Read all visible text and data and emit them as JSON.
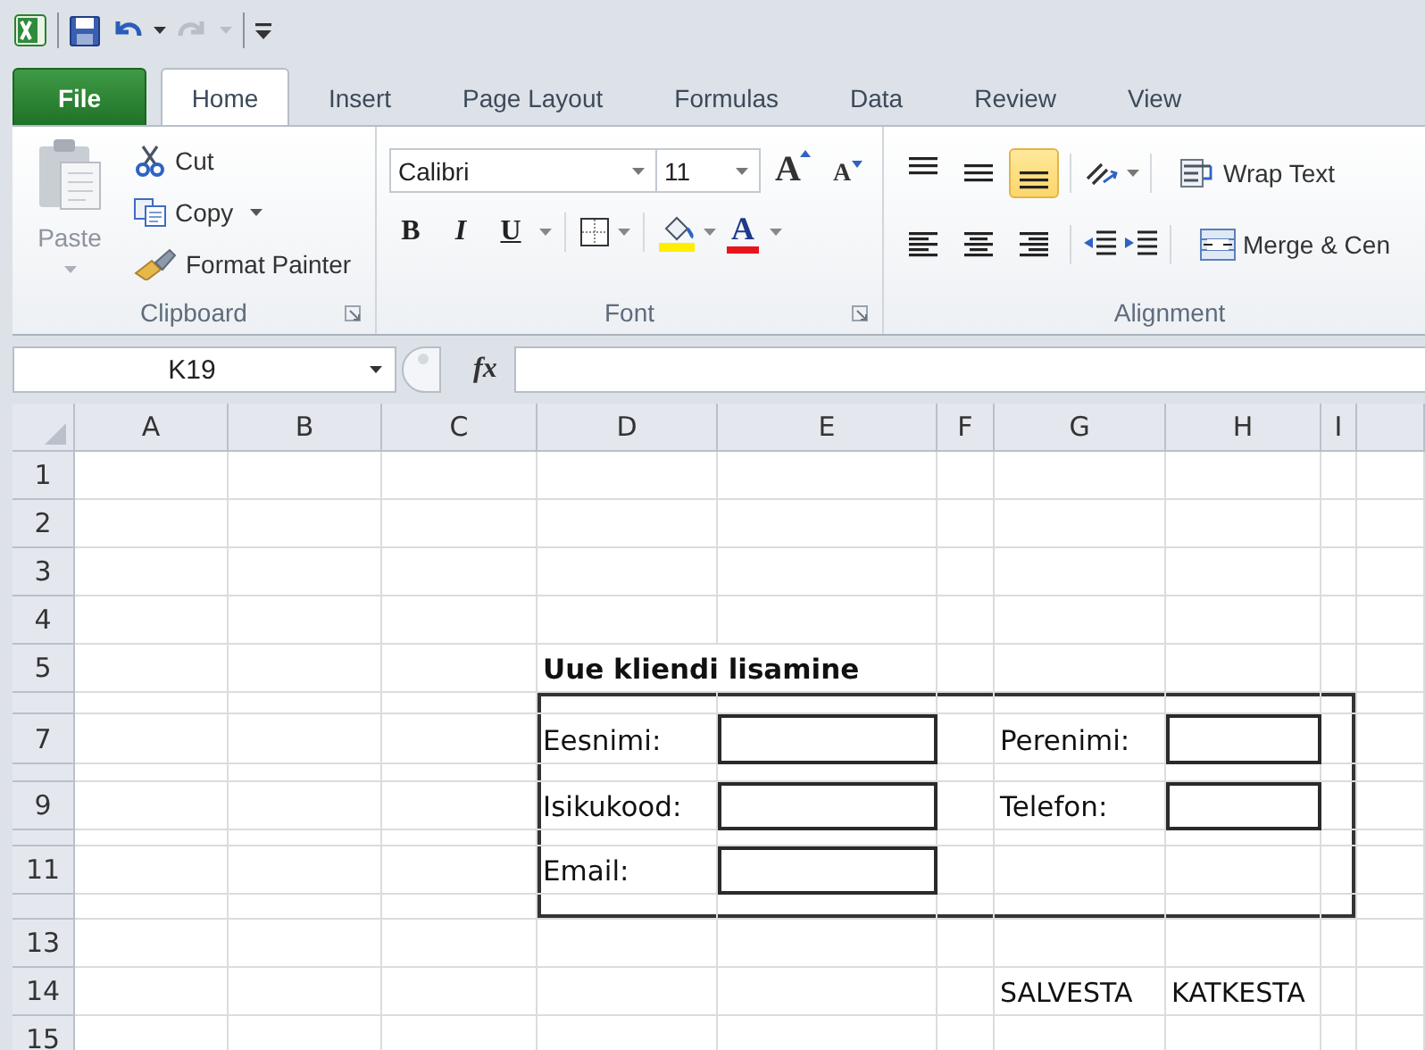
{
  "tabs": [
    {
      "label": "File",
      "kind": "backstage",
      "selected": false
    },
    {
      "label": "Home",
      "kind": "tab",
      "selected": true
    },
    {
      "label": "Insert",
      "kind": "tab",
      "selected": false
    },
    {
      "label": "Page Layout",
      "kind": "tab",
      "selected": false
    },
    {
      "label": "Formulas",
      "kind": "tab",
      "selected": false
    },
    {
      "label": "Data",
      "kind": "tab",
      "selected": false
    },
    {
      "label": "Review",
      "kind": "tab",
      "selected": false
    },
    {
      "label": "View",
      "kind": "tab",
      "selected": false
    }
  ],
  "clipboard": {
    "paste": {
      "label": "Paste",
      "disabled": true
    },
    "commands": [
      {
        "label": "Cut",
        "kind": "cut",
        "dropdown": false
      },
      {
        "label": "Copy",
        "kind": "copy",
        "dropdown": true
      },
      {
        "label": "Format Painter",
        "kind": "painter",
        "dropdown": false
      }
    ],
    "group_label": "Clipboard"
  },
  "font": {
    "name": "Calibri",
    "size": "11",
    "grow_label": "A",
    "shrink_label": "A",
    "styles": [
      {
        "label": "B",
        "kind": "bold"
      },
      {
        "label": "I",
        "kind": "italic"
      },
      {
        "label": "U",
        "kind": "underline"
      }
    ],
    "font_color_label": "A",
    "group_label": "Font"
  },
  "alignment": {
    "vertical": [
      {
        "kind": "top",
        "selected": false
      },
      {
        "kind": "middle",
        "selected": false
      },
      {
        "kind": "bottom",
        "selected": true
      }
    ],
    "horizontal": [
      {
        "kind": "left",
        "selected": false
      },
      {
        "kind": "center",
        "selected": false
      },
      {
        "kind": "right",
        "selected": false
      }
    ],
    "wrap_text": "Wrap Text",
    "merge": "Merge & Cen",
    "group_label": "Alignment"
  },
  "name_box": "K19",
  "function_label": "fx",
  "sheet": {
    "columns": [
      "A",
      "B",
      "C",
      "D",
      "E",
      "F",
      "G",
      "H",
      "I"
    ],
    "rows": [
      {
        "label": "1",
        "kind": "normal"
      },
      {
        "label": "2",
        "kind": "normal"
      },
      {
        "label": "3",
        "kind": "normal"
      },
      {
        "label": "4",
        "kind": "normal"
      },
      {
        "label": "5",
        "kind": "normal"
      },
      {
        "kind": "thin"
      },
      {
        "label": "7",
        "kind": "normal"
      },
      {
        "kind": "narrow"
      },
      {
        "label": "9",
        "kind": "normal"
      },
      {
        "kind": "narrow"
      },
      {
        "label": "11",
        "kind": "normal"
      },
      {
        "kind": "thin"
      },
      {
        "label": "13",
        "kind": "normal"
      },
      {
        "label": "14",
        "kind": "normal"
      },
      {
        "label": "15",
        "kind": "normal"
      }
    ]
  },
  "form": {
    "title": "Uue kliendi lisamine",
    "fields": [
      {
        "label": "Eesnimi:"
      },
      {
        "label": "Perenimi:"
      },
      {
        "label": "Isikukood:"
      },
      {
        "label": "Telefon:"
      },
      {
        "label": "Email:"
      }
    ],
    "actions": [
      "SALVESTA",
      "KATKESTA"
    ]
  }
}
